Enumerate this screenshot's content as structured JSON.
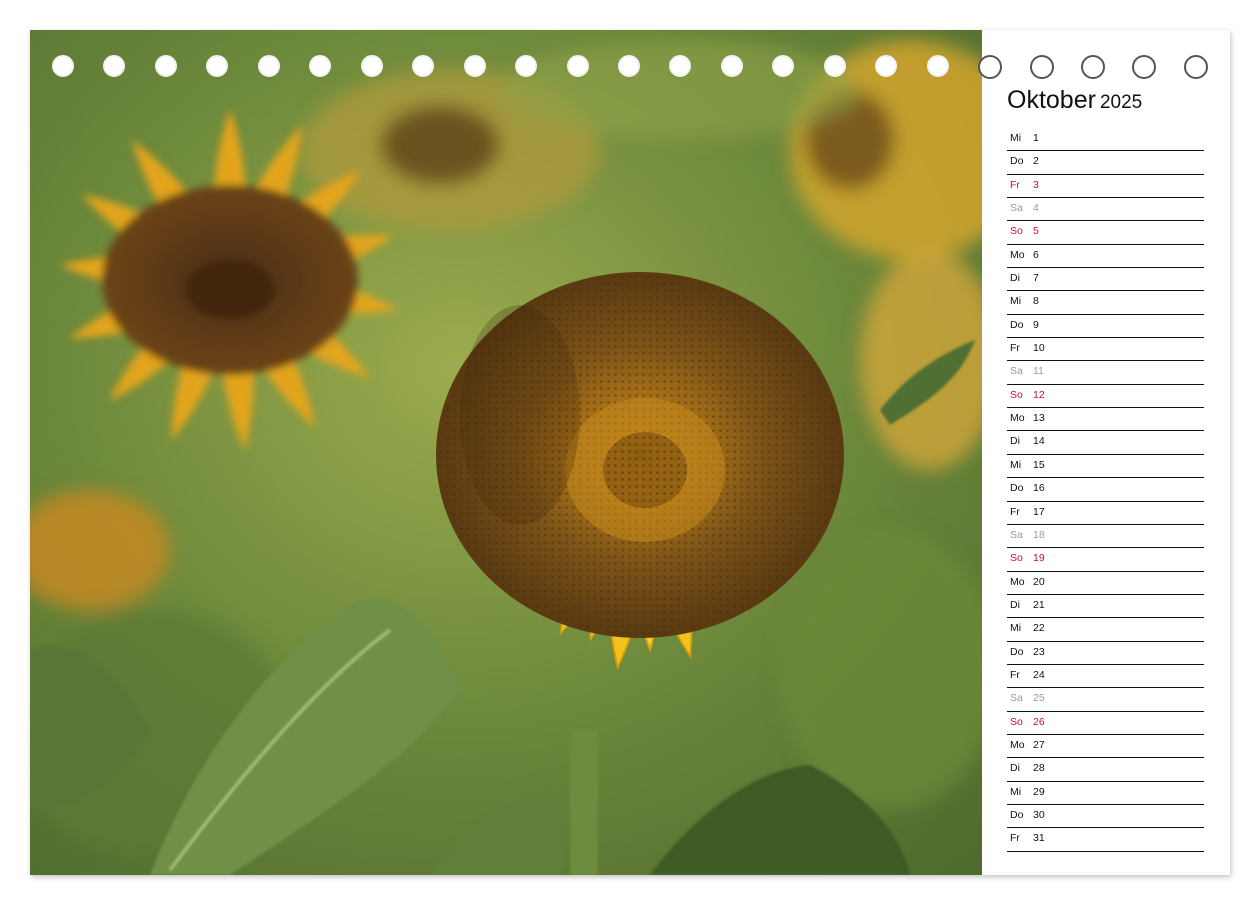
{
  "calendar": {
    "month": "Oktober",
    "year": "2025",
    "days": [
      {
        "weekday": "Mi",
        "day": "1",
        "type": "weekday"
      },
      {
        "weekday": "Do",
        "day": "2",
        "type": "weekday"
      },
      {
        "weekday": "Fr",
        "day": "3",
        "type": "holiday"
      },
      {
        "weekday": "Sa",
        "day": "4",
        "type": "saturday"
      },
      {
        "weekday": "So",
        "day": "5",
        "type": "sunday"
      },
      {
        "weekday": "Mo",
        "day": "6",
        "type": "weekday"
      },
      {
        "weekday": "Di",
        "day": "7",
        "type": "weekday"
      },
      {
        "weekday": "Mi",
        "day": "8",
        "type": "weekday"
      },
      {
        "weekday": "Do",
        "day": "9",
        "type": "weekday"
      },
      {
        "weekday": "Fr",
        "day": "10",
        "type": "weekday"
      },
      {
        "weekday": "Sa",
        "day": "11",
        "type": "saturday"
      },
      {
        "weekday": "So",
        "day": "12",
        "type": "sunday"
      },
      {
        "weekday": "Mo",
        "day": "13",
        "type": "weekday"
      },
      {
        "weekday": "Di",
        "day": "14",
        "type": "weekday"
      },
      {
        "weekday": "Mi",
        "day": "15",
        "type": "weekday"
      },
      {
        "weekday": "Do",
        "day": "16",
        "type": "weekday"
      },
      {
        "weekday": "Fr",
        "day": "17",
        "type": "weekday"
      },
      {
        "weekday": "Sa",
        "day": "18",
        "type": "saturday"
      },
      {
        "weekday": "So",
        "day": "19",
        "type": "sunday"
      },
      {
        "weekday": "Mo",
        "day": "20",
        "type": "weekday"
      },
      {
        "weekday": "Di",
        "day": "21",
        "type": "weekday"
      },
      {
        "weekday": "Mi",
        "day": "22",
        "type": "weekday"
      },
      {
        "weekday": "Do",
        "day": "23",
        "type": "weekday"
      },
      {
        "weekday": "Fr",
        "day": "24",
        "type": "weekday"
      },
      {
        "weekday": "Sa",
        "day": "25",
        "type": "saturday"
      },
      {
        "weekday": "So",
        "day": "26",
        "type": "sunday"
      },
      {
        "weekday": "Mo",
        "day": "27",
        "type": "weekday"
      },
      {
        "weekday": "Di",
        "day": "28",
        "type": "weekday"
      },
      {
        "weekday": "Mi",
        "day": "29",
        "type": "weekday"
      },
      {
        "weekday": "Do",
        "day": "30",
        "type": "weekday"
      },
      {
        "weekday": "Fr",
        "day": "31",
        "type": "weekday"
      }
    ]
  },
  "photo": {
    "subject": "sunflower-photo"
  },
  "binding": {
    "hole_count": 23,
    "holes_on_photo": 18
  },
  "colors": {
    "sunday_red": "#c8102e",
    "saturday_gray": "#9a9a9a",
    "text": "#111111",
    "petal_yellow": "#f2c21a",
    "seed_brown": "#6b4412"
  }
}
